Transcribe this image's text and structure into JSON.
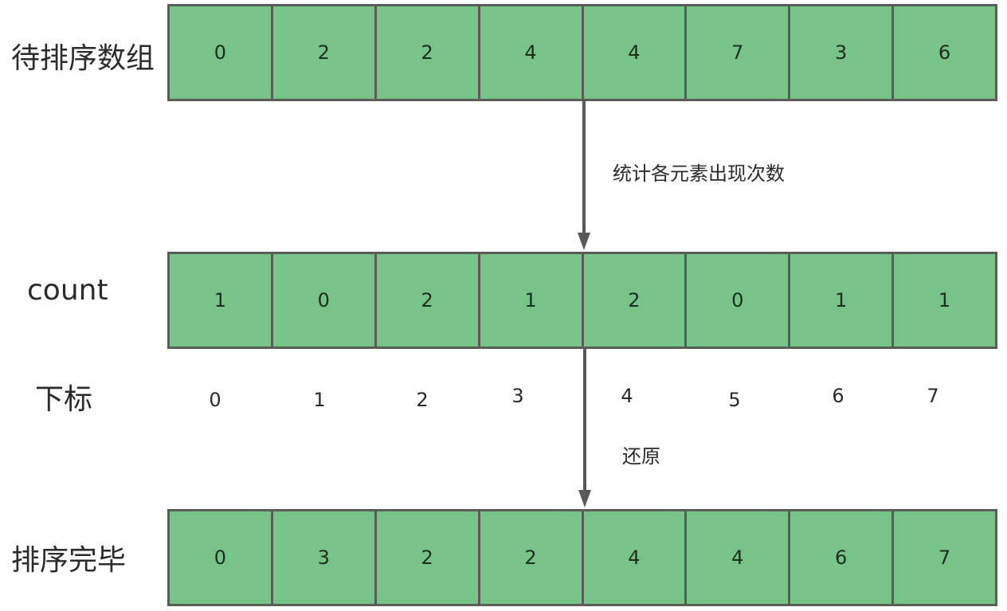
{
  "rows": [
    {
      "label": "待排序数组",
      "values": [
        "0",
        "2",
        "2",
        "4",
        "4",
        "7",
        "3",
        "6"
      ]
    },
    {
      "label": "count",
      "values": [
        "1",
        "0",
        "2",
        "1",
        "2",
        "0",
        "1",
        "1"
      ]
    },
    {
      "label": "排序完毕",
      "values": [
        "0",
        "3",
        "2",
        "2",
        "4",
        "4",
        "6",
        "7"
      ]
    }
  ],
  "index_row": {
    "label": "下标",
    "values": [
      "0",
      "1",
      "2",
      "3",
      "4",
      "5",
      "6",
      "7"
    ]
  },
  "arrows": [
    {
      "label": "统计各元素出现次数"
    },
    {
      "label": "还原"
    }
  ],
  "colors": {
    "cell_fill": "#78c387",
    "border": "#595d59",
    "arrow": "#595959"
  }
}
